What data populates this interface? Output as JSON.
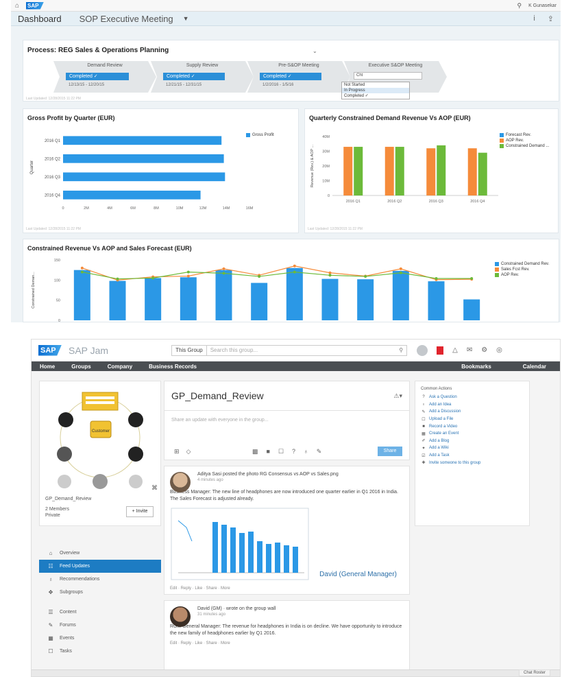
{
  "dashboard": {
    "shell": {
      "user": "K Gunasekar"
    },
    "subbar": {
      "title": "Dashboard",
      "meeting": "SOP Executive Meeting"
    },
    "process": {
      "title": "Process:  REG Sales & Operations Planning",
      "steps": [
        {
          "name": "Demand Review",
          "status": "Completed  ✓",
          "dates": "12/13/15 - 12/20/15"
        },
        {
          "name": "Supply Review",
          "status": "Completed  ✓",
          "dates": "12/21/15 - 12/31/15"
        },
        {
          "name": "Pre-S&OP Meeting",
          "status": "Completed  ✓",
          "dates": "1/2/2016 - 1/5/16"
        },
        {
          "name": "Executive S&OP Meeting",
          "status": "Cht"
        }
      ],
      "dropdown_options": [
        "Not Started",
        "In Progress",
        "Completed ✓"
      ],
      "footnote": "Last Updated: 12/28/2015 11:22 PM"
    },
    "gross_profit": {
      "title": "Gross Profit by Quarter (EUR)",
      "footnote": "Last Updated: 12/28/2015 11:22 PM"
    },
    "quarterly": {
      "title": "Quarterly Constrained Demand Revenue Vs AOP (EUR)",
      "footnote": "Last Updated: 12/28/2015 11:22 PM"
    },
    "constrained": {
      "title": "Constrained Revenue Vs AOP and Sales Forecast (EUR)"
    }
  },
  "chart_data": [
    {
      "type": "bar",
      "orientation": "horizontal",
      "categories": [
        "2016 Q1",
        "2016 Q2",
        "2016 Q3",
        "2016 Q4"
      ],
      "series": [
        {
          "name": "Gross Profit",
          "values": [
            13.6,
            13.8,
            13.9,
            11.8
          ],
          "color": "#2b98e6"
        }
      ],
      "xlabel": "",
      "ylabel": "Quarter",
      "xticks": [
        "0",
        "2M",
        "4M",
        "6M",
        "8M",
        "10M",
        "12M",
        "14M",
        "16M"
      ],
      "xlim": [
        0,
        16
      ],
      "legend": "top-right"
    },
    {
      "type": "bar",
      "categories": [
        "2016 Q1",
        "2016 Q2",
        "2016 Q3",
        "2016 Q4"
      ],
      "series": [
        {
          "name": "Forecast Rev.",
          "values": [
            0,
            0,
            0,
            0
          ],
          "color": "#2b98e6"
        },
        {
          "name": "AOP Rev.",
          "values": [
            33,
            33,
            32,
            32
          ],
          "color": "#f58b3a"
        },
        {
          "name": "Constrained Demand ...",
          "values": [
            33,
            33,
            34,
            29
          ],
          "color": "#6cba3a"
        }
      ],
      "ylabel": "Revenue (Rev.) & AOP ...",
      "yticks": [
        "0",
        "10M",
        "20M",
        "30M",
        "40M"
      ],
      "ylim": [
        0,
        40
      ],
      "legend": "top-right"
    },
    {
      "type": "bar+line",
      "categories": [
        "Jan 2016",
        "Feb 2016",
        "Mar 2016",
        "Apr 2016",
        "May 2016",
        "Jun 2016",
        "Jul 2016",
        "Aug 2016",
        "Sep 2016",
        "Oct 2016",
        "Nov 2016",
        "Dec 2016"
      ],
      "series": [
        {
          "name": "Constrained Demand Rev.",
          "type": "bar",
          "values": [
            125,
            98,
            105,
            107,
            125,
            93,
            130,
            103,
            102,
            123,
            97,
            52
          ],
          "color": "#2b98e6"
        },
        {
          "name": "Sales Fcst Rev.",
          "type": "line",
          "values": [
            130,
            100,
            108,
            110,
            128,
            112,
            135,
            118,
            110,
            128,
            101,
            102
          ],
          "color": "#f58b3a"
        },
        {
          "name": "AOP Rev.",
          "type": "line",
          "values": [
            120,
            103,
            105,
            120,
            117,
            109,
            120,
            112,
            109,
            118,
            104,
            104
          ],
          "color": "#6cba3a"
        }
      ],
      "ylabel": "Constrained Deman...",
      "yticks": [
        "0",
        "50",
        "100",
        "150"
      ],
      "ylim": [
        0,
        150
      ],
      "legend": "top-right"
    }
  ],
  "jam": {
    "app_title": "SAP Jam",
    "group_selector": "This Group",
    "search_placeholder": "Search this group...",
    "nav": [
      "Home",
      "Groups",
      "Company",
      "Business Records"
    ],
    "nav_right": [
      "Bookmarks",
      "Calendar"
    ],
    "group": {
      "name": "GP_Demand_Review",
      "members": "2 Members",
      "visibility": "Private",
      "invite": "+ Invite",
      "image_labels": {
        "center": "Customer"
      }
    },
    "left_nav": {
      "group1": [
        "Overview",
        "Feed Updates",
        "Recommendations",
        "Subgroups"
      ],
      "group2": [
        "Content",
        "Forums",
        "Events",
        "Tasks"
      ]
    },
    "poster": {
      "placeholder": "Share an update with everyone in the group...",
      "share": "Share"
    },
    "feed": [
      {
        "author_line": "Aditya Sasi posted the photo RG Consensus vs AOP vs Sales.png",
        "time": "4 minutes ago",
        "body": "Business Manager: The new line of headphones are now introduced one quarter earlier in Q1 2016 in India. The Sales Forecast is adjusted already.",
        "caption": "David (General Manager)",
        "actions": "Edit · Reply · Like · Share · More"
      },
      {
        "author_line": "David (GM) · wrote on the group wall",
        "time": "31 minutes ago",
        "body": "RGM General Manager: The revenue for headphones in India is on decline. We have opportunity to introduce the new family of headphones earlier by Q1 2016.",
        "actions": "Edit · Reply · Like · Share · More"
      }
    ],
    "common_actions": {
      "title": "Common Actions",
      "items": [
        "Ask a Question",
        "Add an Idea",
        "Add a Discussion",
        "Upload a File",
        "Record a Video",
        "Create an Event",
        "Add a Blog",
        "Add a Wiki",
        "Add a Task",
        "Invite someone to this group"
      ]
    },
    "chat": "Chat Roster"
  }
}
